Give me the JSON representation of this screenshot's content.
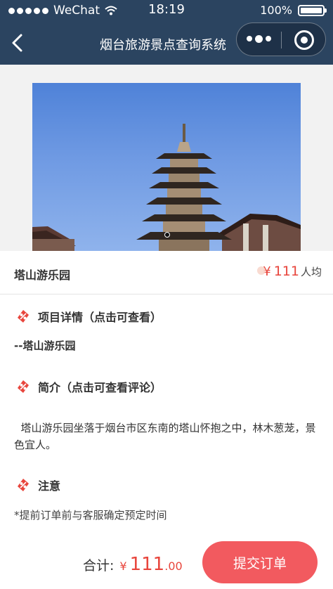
{
  "status_bar": {
    "carrier": "WeChat",
    "time": "18:19",
    "battery": "100%"
  },
  "nav": {
    "title": "烟台旅游景点查询系统",
    "icons": [
      "back-arrow-icon",
      "more-dots-icon",
      "close-target-icon"
    ]
  },
  "banner": {
    "image": "pagoda-photo",
    "indicator_count": 1
  },
  "item": {
    "name": "塔山游乐园",
    "price_symbol": "¥",
    "price": "111",
    "price_unit": "人均"
  },
  "sections": [
    {
      "icon": "tag-icon",
      "title": "项目详情（点击可查看）",
      "content": "--塔山游乐园"
    },
    {
      "icon": "tag-icon",
      "title": "简介（点击可查看评论）",
      "content": "  塔山游乐园坐落于烟台市区东南的塔山怀抱之中，林木葱茏，景色宜人。"
    },
    {
      "icon": "tag-icon",
      "title": "注意",
      "content": "*提前订单前与客服确定预定时间"
    }
  ],
  "footer": {
    "total_label": "合计:",
    "currency": "¥",
    "total_integer": "111",
    "total_decimal": ".00",
    "submit_label": "提交订单"
  },
  "colors": {
    "header_bg": "#2b4460",
    "accent_red": "#e8453c",
    "button_bg": "#f25a5f"
  }
}
